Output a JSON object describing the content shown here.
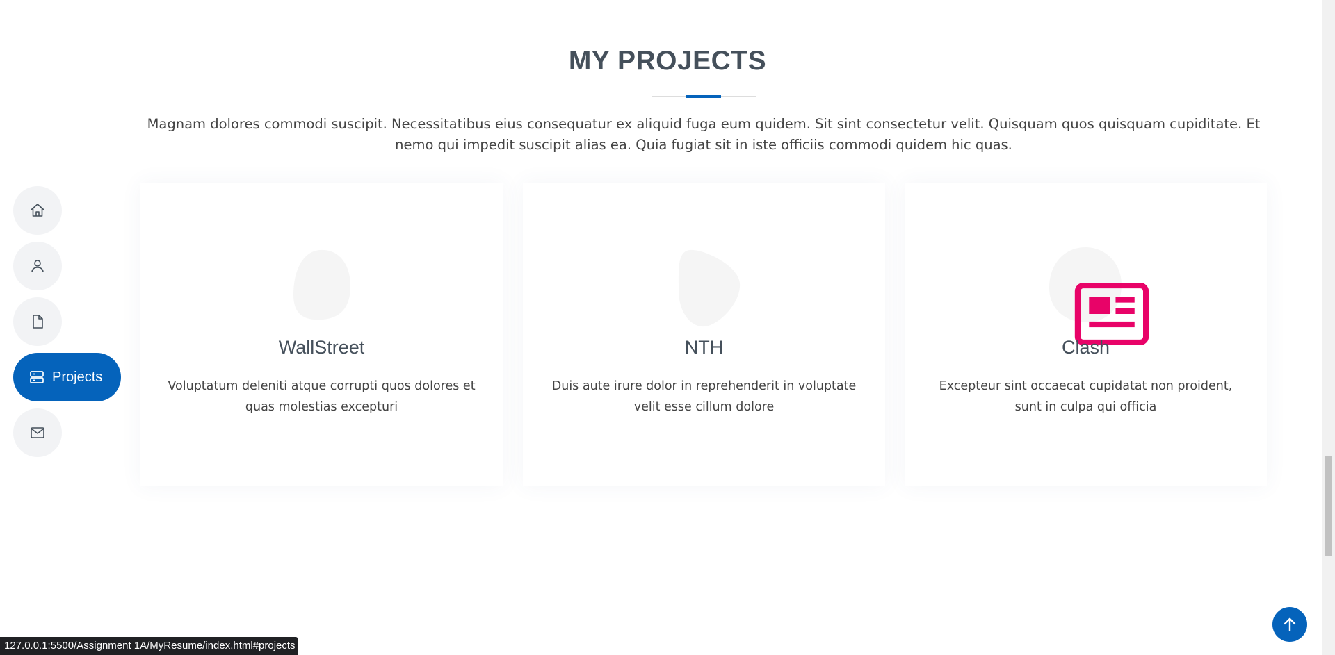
{
  "section": {
    "title": "MY PROJECTS",
    "description": "Magnam dolores commodi suscipit. Necessitatibus eius consequatur ex aliquid fuga eum quidem. Sit sint consectetur velit. Quisquam quos quisquam cupiditate. Et nemo qui impedit suscipit alias ea. Quia fugiat sit in iste officiis commodi quidem hic quas.",
    "accent_color": "#0563bb"
  },
  "projects": [
    {
      "title": "WallStreet",
      "description": "Voluptatum deleniti atque corrupti quos dolores et quas molestias excepturi",
      "icon": "blob-icon"
    },
    {
      "title": "NTH",
      "description": "Duis aute irure dolor in reprehenderit in voluptate velit esse cillum dolore",
      "icon": "blob-icon"
    },
    {
      "title": "Clash",
      "description": "Excepteur sint occaecat cupidatat non proident, sunt in culpa qui officia",
      "icon": "newspaper-icon",
      "icon_color": "#e80368"
    }
  ],
  "nav": {
    "items": [
      {
        "name": "home",
        "icon": "home-icon"
      },
      {
        "name": "about",
        "icon": "person-icon"
      },
      {
        "name": "resume",
        "icon": "file-icon"
      },
      {
        "name": "projects",
        "icon": "server-icon",
        "label": "Projects",
        "active": true
      },
      {
        "name": "contact",
        "icon": "envelope-icon"
      }
    ]
  },
  "back_to_top": {
    "icon": "arrow-up-icon"
  },
  "status_bar": {
    "url": "127.0.0.1:5500/Assignment 1A/MyResume/index.html#projects"
  }
}
